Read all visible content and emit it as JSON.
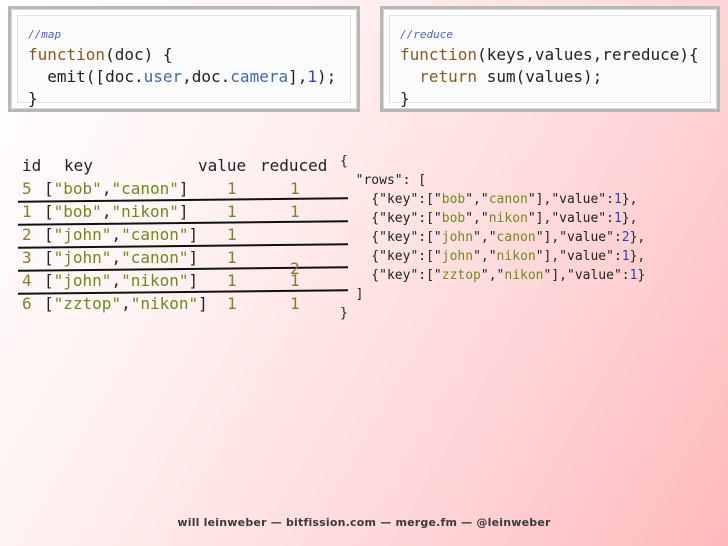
{
  "map_code": {
    "comment": "//map",
    "line1_kw": "function",
    "line1_rest": "(doc) {",
    "line2_a": "  emit([doc.",
    "line2_user": "user",
    "line2_b": ",doc.",
    "line2_camera": "camera",
    "line2_c": "],",
    "line2_num": "1",
    "line2_d": ");",
    "line3": "}"
  },
  "reduce_code": {
    "comment": "//reduce",
    "line1_kw": "function",
    "line1_rest": "(keys,values,rereduce){",
    "line2_indent": "  ",
    "line2_kw": "return",
    "line2_rest": " sum(values);",
    "line3": "}"
  },
  "table": {
    "headers": {
      "id": "id",
      "key": "key",
      "value": "value",
      "reduced": "reduced"
    },
    "rows": [
      {
        "id": "5",
        "user": "\"bob\"",
        "camera": "\"canon\"",
        "value": "1",
        "reduced": "1",
        "struck": false
      },
      {
        "id": "1",
        "user": "\"bob\"",
        "camera": "\"nikon\"",
        "value": "1",
        "reduced": "1",
        "struck": true
      },
      {
        "id": "2",
        "user": "\"john\"",
        "camera": "\"canon\"",
        "value": "1",
        "reduced": "",
        "struck": true
      },
      {
        "id": "3",
        "user": "\"john\"",
        "camera": "\"canon\"",
        "value": "1",
        "reduced": "",
        "struck": true
      },
      {
        "id": "4",
        "user": "\"john\"",
        "camera": "\"nikon\"",
        "value": "1",
        "reduced": "1",
        "struck": true
      },
      {
        "id": "6",
        "user": "\"zztop\"",
        "camera": "\"nikon\"",
        "value": "1",
        "reduced": "1",
        "struck": false
      }
    ],
    "merged_reduced": "2"
  },
  "json_output": {
    "open_brace": "{",
    "rows_open": "  \"rows\": [",
    "rows": [
      {
        "user": "bob",
        "camera": "canon",
        "value": "1",
        "sep": ","
      },
      {
        "user": "bob",
        "camera": "nikon",
        "value": "1",
        "sep": ","
      },
      {
        "user": "john",
        "camera": "canon",
        "value": "2",
        "sep": ","
      },
      {
        "user": "john",
        "camera": "nikon",
        "value": "1",
        "sep": ","
      },
      {
        "user": "zztop",
        "camera": "nikon",
        "value": "1",
        "sep": ""
      }
    ],
    "rows_close": "  ]",
    "close_brace": "}"
  },
  "footer": "will leinweber — bitfission.com — merge.fm — @leinweber"
}
